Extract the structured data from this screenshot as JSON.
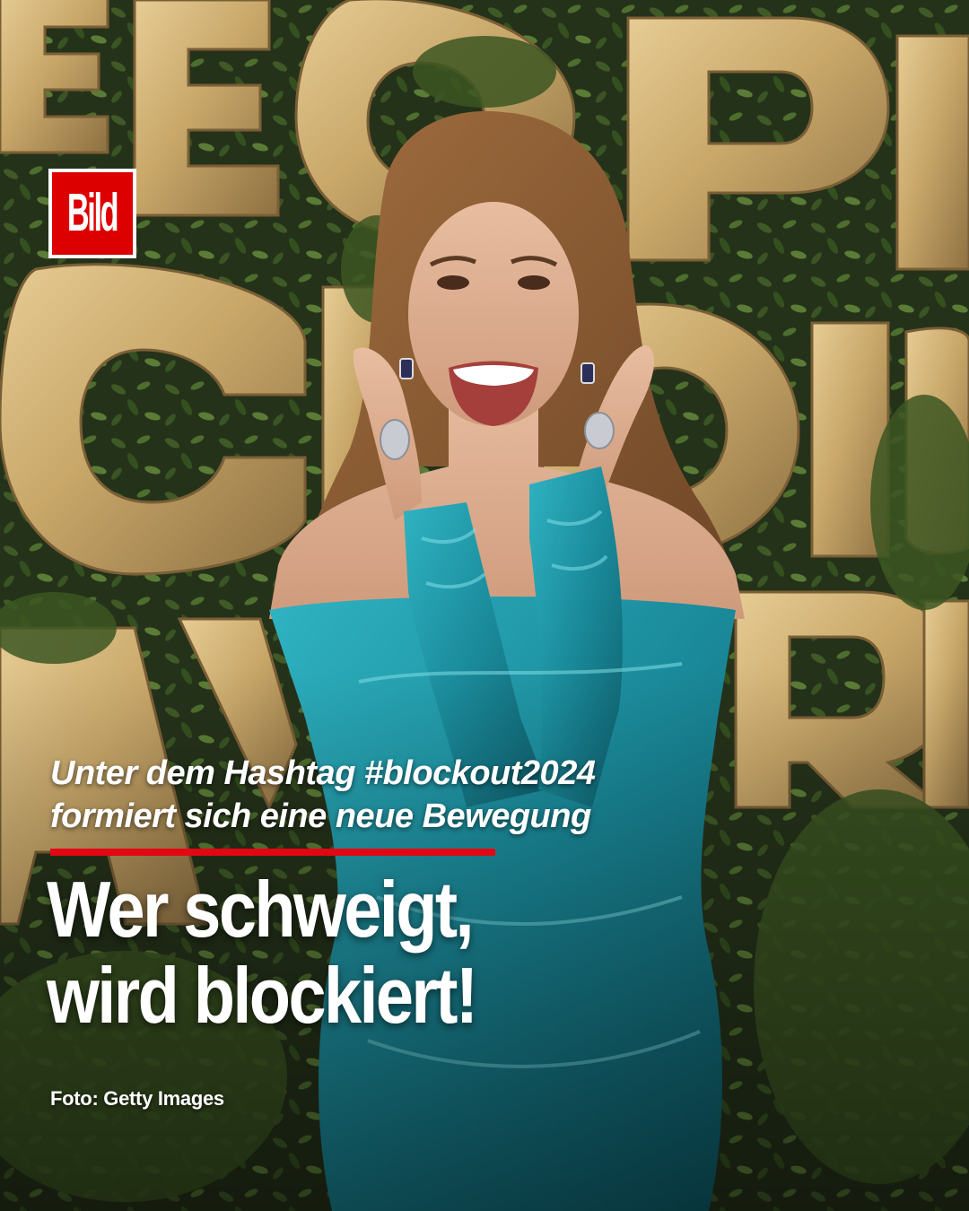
{
  "brand": {
    "logo_text": "Bild",
    "logo_color": "#dd0000"
  },
  "backdrop": {
    "sign_letters_row1": "EOPL",
    "sign_letters_row2": "CHOIC",
    "sign_letters_row3": "AWAR",
    "sign_color": "#c9a86a",
    "foliage_color": "#2c3a1c"
  },
  "photo": {
    "dress_color": "#1a8a9a",
    "hair_color": "#8a5a32",
    "skin_color": "#d9a98a"
  },
  "article": {
    "kicker_line1": "Unter dem Hashtag #blockout2024",
    "kicker_line2": "formiert sich eine neue Bewegung",
    "rule_color": "#e30613",
    "headline_line1": "Wer schweigt,",
    "headline_line2": "wird blockiert!",
    "credit": "Foto: Getty Images"
  }
}
